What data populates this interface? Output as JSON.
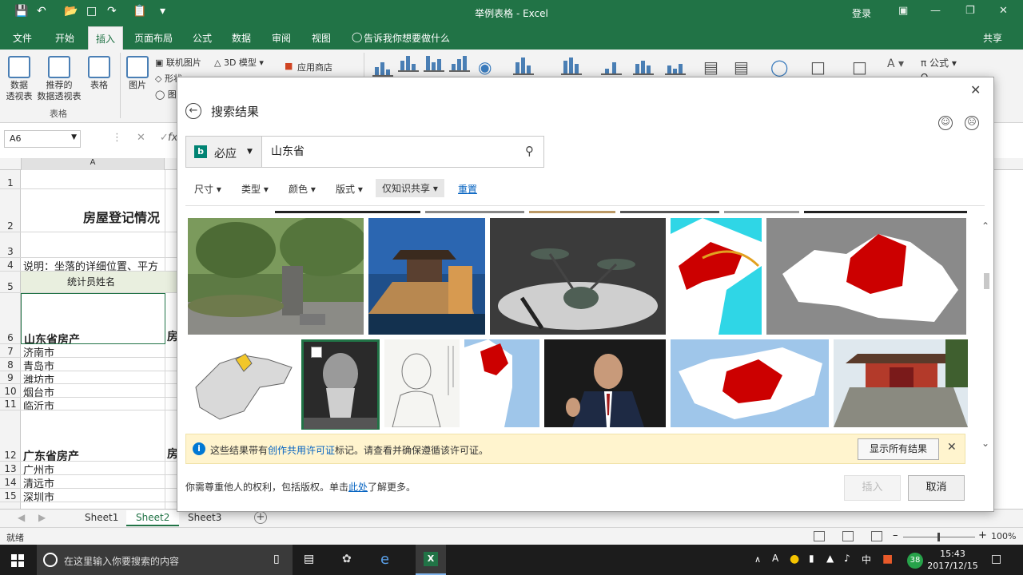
{
  "window": {
    "title": "举例表格 - Excel",
    "login_label": "登录",
    "share_label": "共享"
  },
  "ribbon_tabs": [
    "文件",
    "开始",
    "插入",
    "页面布局",
    "公式",
    "数据",
    "审阅",
    "视图"
  ],
  "active_tab": "插入",
  "tell_me": "告诉我你想要做什么",
  "ribbon": {
    "pivot_table": "数据\n透视表",
    "recommended_pivot": "推荐的\n数据透视表",
    "table": "表格",
    "group_tables": "表格",
    "pictures": "图片",
    "online_pictures": "联机图片",
    "shapes": "形状",
    "models_3d": "3D 模型",
    "app_store": "应用商店",
    "equation": "公式"
  },
  "formula_bar": {
    "name_box": "A6",
    "fx": "fx"
  },
  "sheet": {
    "column_a": "A",
    "rows": [
      {
        "num": "1",
        "text": "",
        "height": 24
      },
      {
        "num": "2",
        "text": "房屋登记情况",
        "height": 54,
        "bold": true
      },
      {
        "num": "3",
        "text": "",
        "height": 32
      },
      {
        "num": "4",
        "text": "说明：坐落的详细位置、平方",
        "height": 17
      },
      {
        "num": "5",
        "text": "统计员姓名",
        "height": 27
      },
      {
        "num": "6",
        "text": "山东省房产",
        "height": 64,
        "bold": true
      },
      {
        "num": "7",
        "text": "济南市",
        "height": 17
      },
      {
        "num": "8",
        "text": "青岛市",
        "height": 17
      },
      {
        "num": "9",
        "text": "潍坊市",
        "height": 16
      },
      {
        "num": "10",
        "text": "烟台市",
        "height": 17
      },
      {
        "num": "11",
        "text": "临沂市",
        "height": 16
      },
      {
        "num": "12",
        "text": "广东省房产",
        "height": 64,
        "bold": true
      },
      {
        "num": "13",
        "text": "广州市",
        "height": 17
      },
      {
        "num": "14",
        "text": "清远市",
        "height": 17
      },
      {
        "num": "15",
        "text": "深圳市",
        "height": 17
      }
    ],
    "partial_col_b": "房"
  },
  "sheet_tabs": [
    "Sheet1",
    "Sheet2",
    "Sheet3"
  ],
  "active_sheet": "Sheet2",
  "status": {
    "ready": "就绪",
    "zoom": "100%"
  },
  "dialog": {
    "title": "搜索结果",
    "search_engine": "必应",
    "query": "山东省",
    "filters": [
      "尺寸",
      "类型",
      "颜色",
      "版式",
      "仅知识共享"
    ],
    "reset": "重置",
    "info_message_prefix": "这些结果带有",
    "info_message_link": "创作共用许可证",
    "info_message_suffix": "标记。请查看并确保遵循该许可证。",
    "show_all": "显示所有结果",
    "footer_prefix": "你需尊重他人的权利，包括版权。单击",
    "footer_link": "此处",
    "footer_suffix": "了解更多。",
    "insert": "插入",
    "cancel": "取消"
  },
  "taskbar": {
    "search_placeholder": "在这里输入你要搜索的内容",
    "time": "15:43",
    "date": "2017/12/15",
    "badge": "38",
    "ime": "中",
    "excel_icon": "X"
  }
}
